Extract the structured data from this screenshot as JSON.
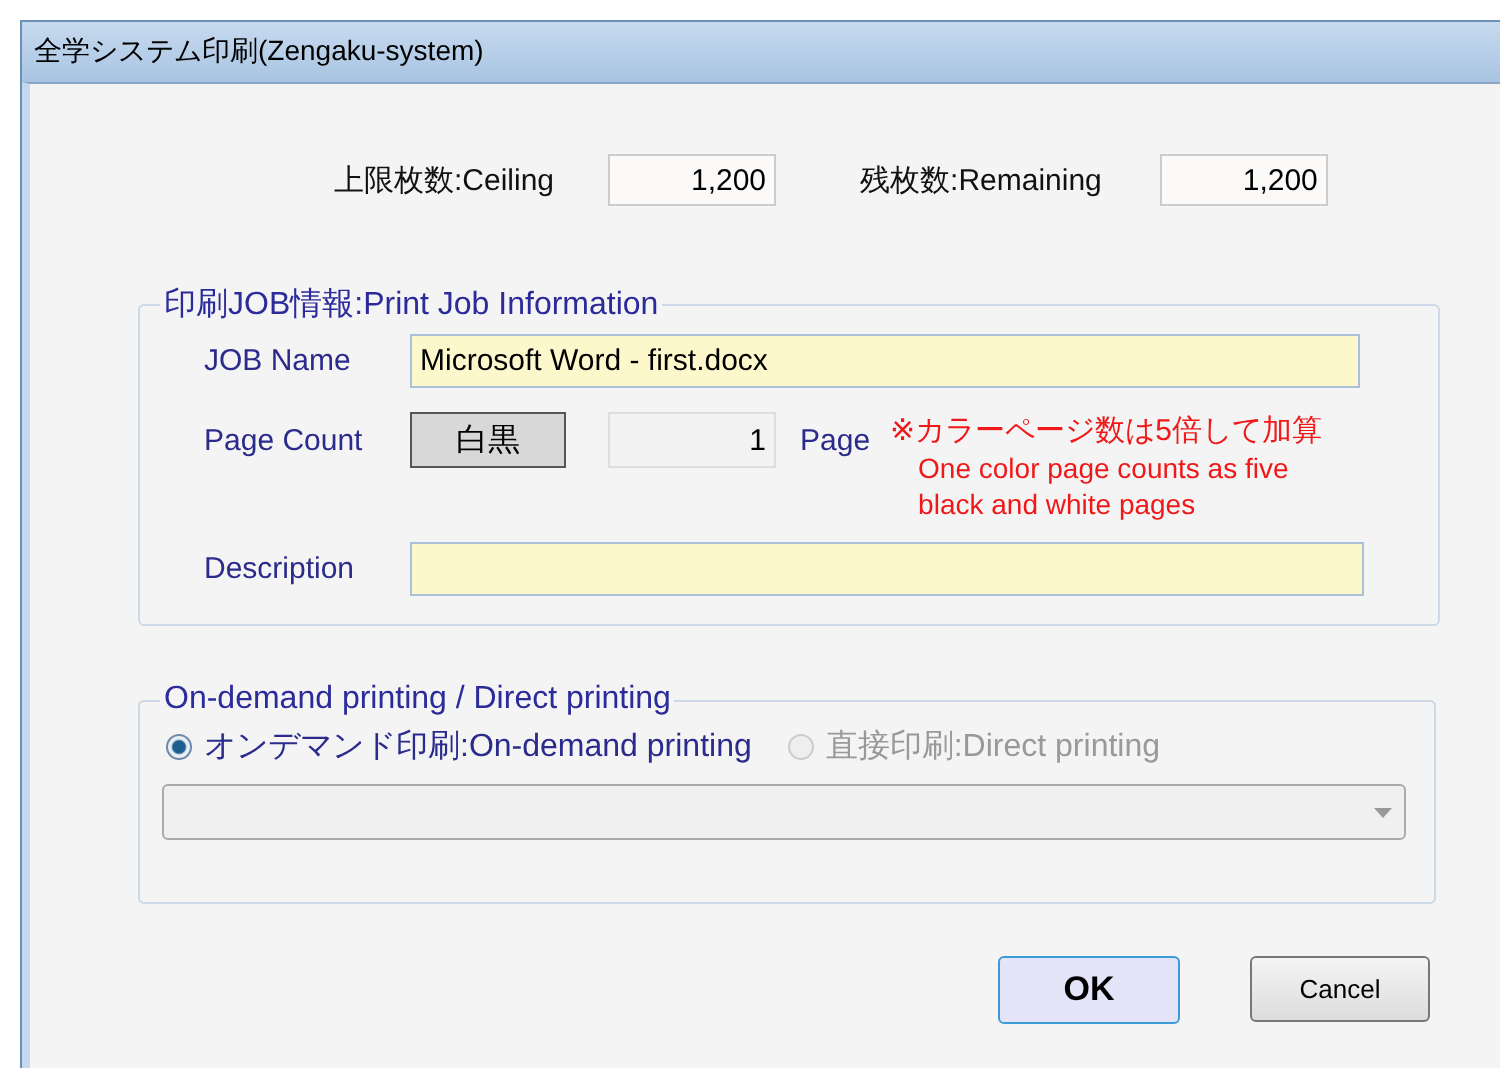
{
  "window": {
    "title": "全学システム印刷(Zengaku-system)"
  },
  "counts": [
    {
      "label": "上限枚数:Ceiling",
      "value": "1,200"
    },
    {
      "label": "残枚数:Remaining",
      "value": "1,200"
    }
  ],
  "job_info": {
    "legend": "印刷JOB情報:Print Job Information",
    "job_name": {
      "label": "JOB Name",
      "value": "Microsoft Word - first.docx"
    },
    "page_count": {
      "label": "Page Count",
      "mode_button": "白黒",
      "value": "1",
      "unit": "Page",
      "note": "※カラーページ数は5倍して加算",
      "note_lines": [
        "One color page counts as five",
        "black and white pages"
      ]
    },
    "description": {
      "label": "Description"
    }
  },
  "print_mode": {
    "legend": "On-demand printing / Direct printing",
    "options": [
      {
        "label": "オンデマンド印刷:On-demand printing",
        "selected": true,
        "disabled": false
      },
      {
        "label": "直接印刷:Direct printing",
        "selected": false,
        "disabled": true
      }
    ]
  },
  "buttons": [
    {
      "label": "OK",
      "default": true
    },
    {
      "label": "Cancel",
      "default": false
    }
  ]
}
